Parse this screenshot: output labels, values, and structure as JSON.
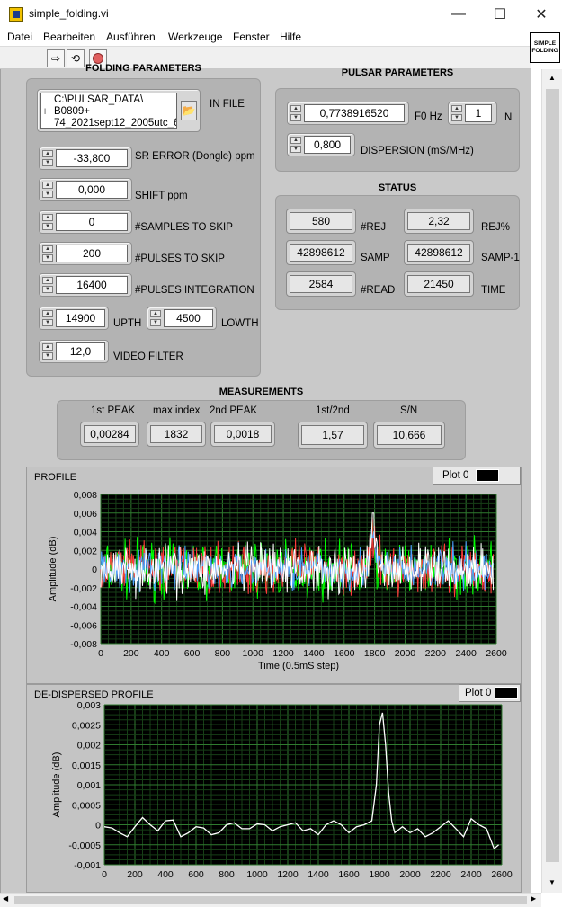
{
  "window": {
    "title": "simple_folding.vi",
    "minimize": "—",
    "maximize": "☐",
    "close": "✕"
  },
  "menu": [
    "Datei",
    "Bearbeiten",
    "Ausführen",
    "Werkzeuge",
    "Fenster",
    "Hilfe"
  ],
  "vi_icon": {
    "line1": "SIMPLE",
    "line2": "FOLDING"
  },
  "folding": {
    "title": "FOLDING PARAMETERS",
    "in_file_label": "IN FILE",
    "in_file_path": [
      "C:\\PULSAR_DATA\\",
      "B0809+",
      "74_2021sept12_2005utc_6"
    ],
    "sr_error": {
      "value": "-33,800",
      "label": "SR ERROR (Dongle) ppm"
    },
    "shift": {
      "value": "0,000",
      "label": "SHIFT ppm"
    },
    "samples_skip": {
      "value": "0",
      "label": "#SAMPLES TO SKIP"
    },
    "pulses_skip": {
      "value": "200",
      "label": "#PULSES TO SKIP"
    },
    "pulses_integ": {
      "value": "16400",
      "label": "#PULSES INTEGRATION"
    },
    "upth": {
      "value": "14900",
      "label": "UPTH"
    },
    "lowth": {
      "value": "4500",
      "label": "LOWTH"
    },
    "video": {
      "value": "12,0",
      "label": "VIDEO FILTER"
    }
  },
  "pulsar": {
    "title": "PULSAR PARAMETERS",
    "f0": {
      "value": "0,7738916520",
      "label": "F0 Hz"
    },
    "n": {
      "value": "1",
      "label": "N"
    },
    "dispersion": {
      "value": "0,800",
      "label": "DISPERSION (mS/MHz)"
    }
  },
  "status": {
    "title": "STATUS",
    "rej": {
      "value": "580",
      "label": "#REJ"
    },
    "rej_pct": {
      "value": "2,32",
      "label": "REJ%"
    },
    "samp": {
      "value": "42898612",
      "label": "SAMP"
    },
    "samp1": {
      "value": "42898612",
      "label": "SAMP-1"
    },
    "read": {
      "value": "2584",
      "label": "#READ"
    },
    "time": {
      "value": "21450",
      "label": "TIME"
    }
  },
  "measurements": {
    "title": "MEASUREMENTS",
    "peak1": {
      "label": "1st PEAK",
      "value": "0,00284"
    },
    "maxidx": {
      "label": "max index",
      "value": "1832"
    },
    "peak2": {
      "label": "2nd PEAK",
      "value": "0,0018"
    },
    "ratio": {
      "label": "1st/2nd",
      "value": "1,57"
    },
    "sn": {
      "label": "S/N",
      "value": "10,666"
    }
  },
  "chart_data": [
    {
      "type": "line",
      "title": "PROFILE",
      "legend": "Plot 0",
      "xlabel": "Time (0.5mS step)",
      "ylabel": "Amplitude (dB)",
      "xlim": [
        0,
        2600
      ],
      "ylim": [
        -0.008,
        0.008
      ],
      "xticks": [
        "0",
        "200",
        "400",
        "600",
        "800",
        "1000",
        "1200",
        "1400",
        "1600",
        "1800",
        "2000",
        "2200",
        "2400",
        "2600"
      ],
      "yticks": [
        "0,008",
        "0,006",
        "0,004",
        "0,002",
        "0",
        "-0,002",
        "-0,004",
        "-0,006",
        "-0,008"
      ],
      "grid": true,
      "series": [
        {
          "color": "#ffffff",
          "peak_index": 1790,
          "peak_value": 0.006,
          "noise": 0.0025
        },
        {
          "color": "#00ff00",
          "noise": 0.0028
        },
        {
          "color": "#ff3b3b",
          "noise": 0.0026
        },
        {
          "color": "#4fa3ff",
          "noise": 0.0022
        }
      ]
    },
    {
      "type": "line",
      "title": "DE-DISPERSED PROFILE",
      "legend": "Plot 0",
      "xlabel": "",
      "ylabel": "Amplitude (dB)",
      "xlim": [
        0,
        2600
      ],
      "ylim": [
        -0.001,
        0.003
      ],
      "xticks": [
        "0",
        "200",
        "400",
        "600",
        "800",
        "1000",
        "1200",
        "1400",
        "1600",
        "1800",
        "2000",
        "2200",
        "2400",
        "2600"
      ],
      "yticks": [
        "0,003",
        "0,0025",
        "0,002",
        "0,0015",
        "0,001",
        "0,0005",
        "0",
        "-0,0005",
        "-0,001"
      ],
      "grid": true,
      "series": [
        {
          "color": "#ffffff",
          "x": [
            0,
            50,
            100,
            150,
            200,
            250,
            300,
            350,
            400,
            450,
            500,
            550,
            600,
            650,
            700,
            750,
            800,
            850,
            900,
            950,
            1000,
            1050,
            1100,
            1150,
            1200,
            1250,
            1300,
            1350,
            1400,
            1450,
            1500,
            1550,
            1600,
            1650,
            1700,
            1750,
            1780,
            1800,
            1820,
            1840,
            1860,
            1880,
            1900,
            1950,
            2000,
            2050,
            2100,
            2150,
            2200,
            2250,
            2300,
            2350,
            2400,
            2450,
            2500,
            2550,
            2580
          ],
          "y": [
            -5e-05,
            -8e-05,
            -0.0002,
            -0.0003,
            -5e-05,
            0.00018,
            0.0,
            -0.00015,
            0.0001,
            0.00012,
            -0.0003,
            -0.0002,
            -5e-05,
            -8e-05,
            -0.00025,
            -0.0002,
            0.0,
            5e-05,
            -0.0001,
            -0.0001,
            2e-05,
            0.0,
            -0.00015,
            -5e-05,
            0.0,
            5e-05,
            -0.00015,
            -0.0001,
            -0.00025,
            0.0,
            0.0001,
            0.0,
            -0.0002,
            -5e-05,
            0.0,
            0.0001,
            0.001,
            0.0025,
            0.0028,
            0.002,
            0.0008,
            0.0001,
            -0.0002,
            -5e-05,
            -0.0002,
            -0.0001,
            -0.0003,
            -0.0002,
            -5e-05,
            0.0001,
            -0.0001,
            -0.0003,
            0.00015,
            0.0,
            -0.0001,
            -0.0006,
            -0.0005
          ]
        }
      ]
    }
  ]
}
